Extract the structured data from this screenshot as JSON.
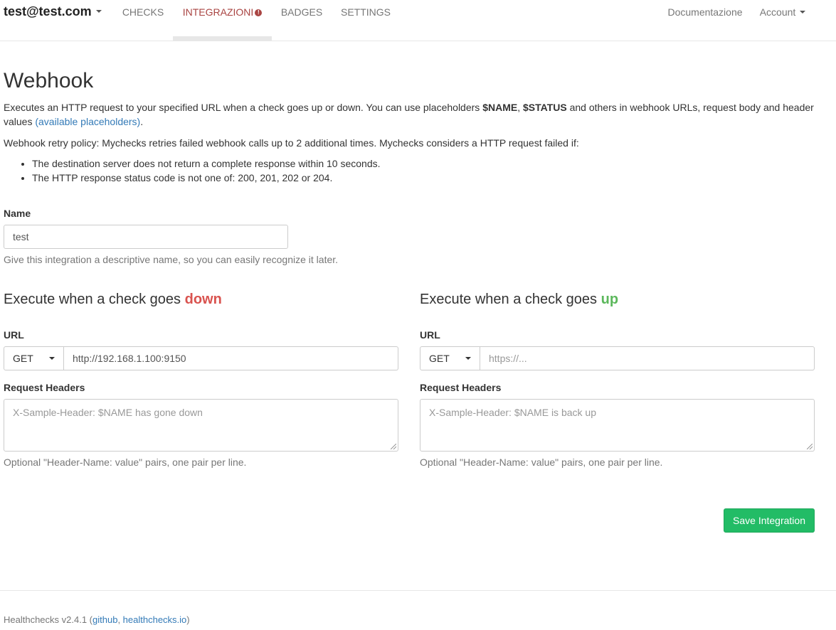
{
  "navbar": {
    "brand": "test@test.com",
    "items": [
      {
        "label": "CHECKS"
      },
      {
        "label": "INTEGRAZIONI",
        "badge": "!"
      },
      {
        "label": "BADGES"
      },
      {
        "label": "SETTINGS"
      }
    ],
    "docs": "Documentazione",
    "account": "Account"
  },
  "page": {
    "title": "Webhook",
    "intro": {
      "text1": "Executes an HTTP request to your specified URL when a check goes up or down. You can use placeholders ",
      "ph_name": "$NAME",
      "sep": ", ",
      "ph_status": "$STATUS",
      "text2": " and others in webhook URLs, request body and header values ",
      "link": "(available placeholders)",
      "text3": "."
    },
    "retry_policy": "Webhook retry policy: Mychecks retries failed webhook calls up to 2 additional times. Mychecks considers a HTTP request failed if:",
    "rules": [
      "The destination server does not return a complete response within 10 seconds.",
      "The HTTP response status code is not one of: 200, 201, 202 or 204."
    ]
  },
  "name_field": {
    "label": "Name",
    "value": "test",
    "help": "Give this integration a descriptive name, so you can easily recognize it later."
  },
  "down": {
    "heading_prefix": "Execute when a check goes ",
    "heading_word": "down",
    "url_label": "URL",
    "method": "GET",
    "url_value": "http://192.168.1.100:9150",
    "headers_label": "Request Headers",
    "headers_placeholder": "X-Sample-Header: $NAME has gone down",
    "headers_help": "Optional \"Header-Name: value\" pairs, one pair per line."
  },
  "up": {
    "heading_prefix": "Execute when a check goes ",
    "heading_word": "up",
    "url_label": "URL",
    "method": "GET",
    "url_placeholder": "https://...",
    "headers_label": "Request Headers",
    "headers_placeholder": "X-Sample-Header: $NAME is back up",
    "headers_help": "Optional \"Header-Name: value\" pairs, one pair per line."
  },
  "save_button": "Save Integration",
  "footer": {
    "version": "Healthchecks v2.4.1 (",
    "github": "github",
    "sep": ", ",
    "site": "healthchecks.io",
    "close": ")"
  },
  "colors": {
    "active_nav": "#a94442",
    "down": "#d9534f",
    "up": "#5cb85c",
    "link": "#337ab7",
    "save": "#22bc66"
  }
}
